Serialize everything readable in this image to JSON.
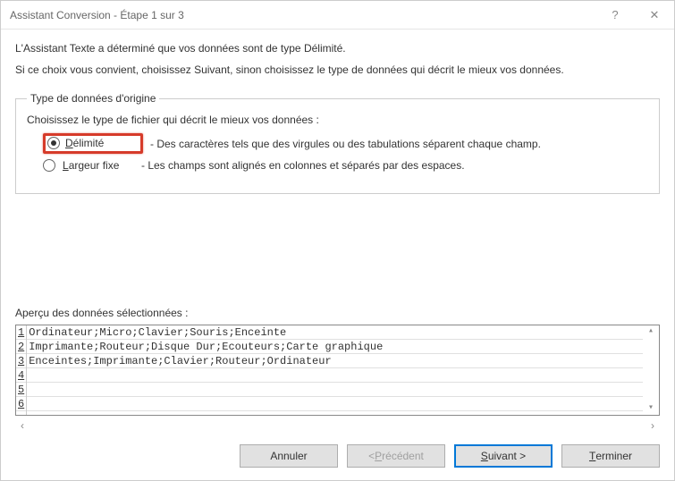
{
  "title": "Assistant Conversion - Étape 1 sur 3",
  "help_glyph": "?",
  "close_glyph": "✕",
  "intro1": "L'Assistant Texte a déterminé que vos données sont de type Délimité.",
  "intro2": "Si ce choix vous convient, choisissez Suivant, sinon choisissez le type de données qui décrit le mieux vos données.",
  "group": {
    "legend": "Type de données d'origine",
    "instruction": "Choisissez le type de fichier qui décrit le mieux vos données :",
    "options": [
      {
        "label_underline": "D",
        "label_rest": "élimité",
        "desc": "- Des caractères tels que des virgules ou des tabulations séparent chaque champ.",
        "selected": true,
        "highlighted": true
      },
      {
        "label_underline": "L",
        "label_rest": "argeur fixe",
        "desc": "- Les champs sont alignés en colonnes et séparés par des espaces.",
        "selected": false,
        "highlighted": false
      }
    ]
  },
  "preview": {
    "label": "Aperçu des données sélectionnées :",
    "rows": [
      "Ordinateur;Micro;Clavier;Souris;Enceinte",
      "Imprimante;Routeur;Disque Dur;Ecouteurs;Carte graphique",
      "Enceintes;Imprimante;Clavier;Routeur;Ordinateur",
      "",
      "",
      ""
    ],
    "line_numbers": [
      "1",
      "2",
      "3",
      "4",
      "5",
      "6"
    ]
  },
  "buttons": {
    "cancel": "Annuler",
    "back_prefix": "< ",
    "back_underline": "P",
    "back_rest": "récédent",
    "next_underline": "S",
    "next_rest": "uivant >",
    "finish_underline": "T",
    "finish_rest": "erminer"
  },
  "scroll": {
    "up": "▴",
    "down": "▾",
    "left": "‹",
    "right": "›"
  }
}
